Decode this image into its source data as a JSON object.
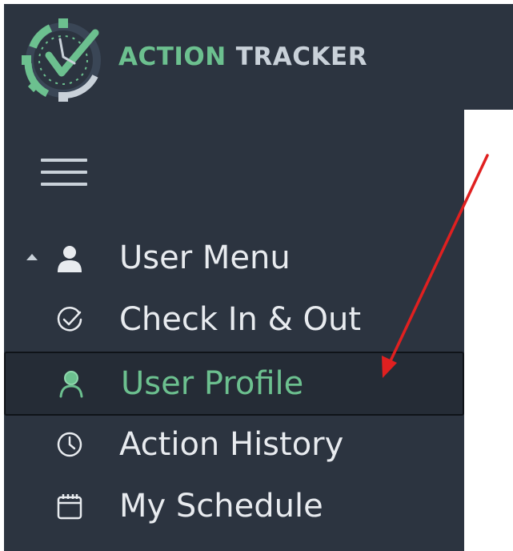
{
  "app": {
    "brand_part1": "ACTION",
    "brand_part2": "TRACKER",
    "accent_color": "#6cc08f",
    "sidebar_color": "#2c3440"
  },
  "sidebar": {
    "toggle_icon": "hamburger-icon",
    "section": {
      "label": "User Menu",
      "icon": "user-icon",
      "expanded": true
    },
    "items": [
      {
        "label": "Check In & Out",
        "icon": "check-circle-icon",
        "active": false
      },
      {
        "label": "User Profile",
        "icon": "user-icon",
        "active": true
      },
      {
        "label": "Action History",
        "icon": "clock-icon",
        "active": false
      },
      {
        "label": "My Schedule",
        "icon": "calendar-icon",
        "active": false
      }
    ]
  },
  "annotation": {
    "arrow_color": "#e02020"
  }
}
